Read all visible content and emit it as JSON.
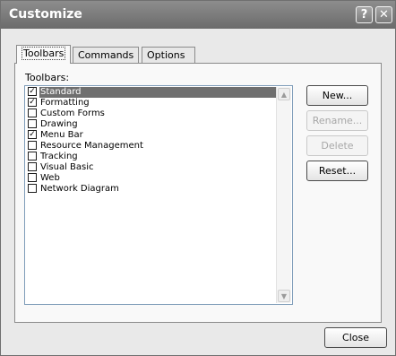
{
  "window": {
    "title": "Customize",
    "help_glyph": "?",
    "close_glyph": "✕"
  },
  "tabs": [
    {
      "label": "Toolbars",
      "active": true
    },
    {
      "label": "Commands",
      "active": false
    },
    {
      "label": "Options",
      "active": false
    }
  ],
  "toolbars_panel": {
    "list_label": "Toolbars:",
    "items": [
      {
        "label": "Standard",
        "checked": true,
        "selected": true
      },
      {
        "label": "Formatting",
        "checked": true,
        "selected": false
      },
      {
        "label": "Custom Forms",
        "checked": false,
        "selected": false
      },
      {
        "label": "Drawing",
        "checked": false,
        "selected": false
      },
      {
        "label": "Menu Bar",
        "checked": true,
        "selected": false
      },
      {
        "label": "Resource Management",
        "checked": false,
        "selected": false
      },
      {
        "label": "Tracking",
        "checked": false,
        "selected": false
      },
      {
        "label": "Visual Basic",
        "checked": false,
        "selected": false
      },
      {
        "label": "Web",
        "checked": false,
        "selected": false
      },
      {
        "label": "Network Diagram",
        "checked": false,
        "selected": false
      }
    ],
    "buttons": {
      "new": "New...",
      "rename": "Rename...",
      "delete": "Delete",
      "reset": "Reset..."
    }
  },
  "footer": {
    "close_label": "Close"
  },
  "icons": {
    "check": "✓",
    "scroll_up": "▲",
    "scroll_down": "▼"
  }
}
